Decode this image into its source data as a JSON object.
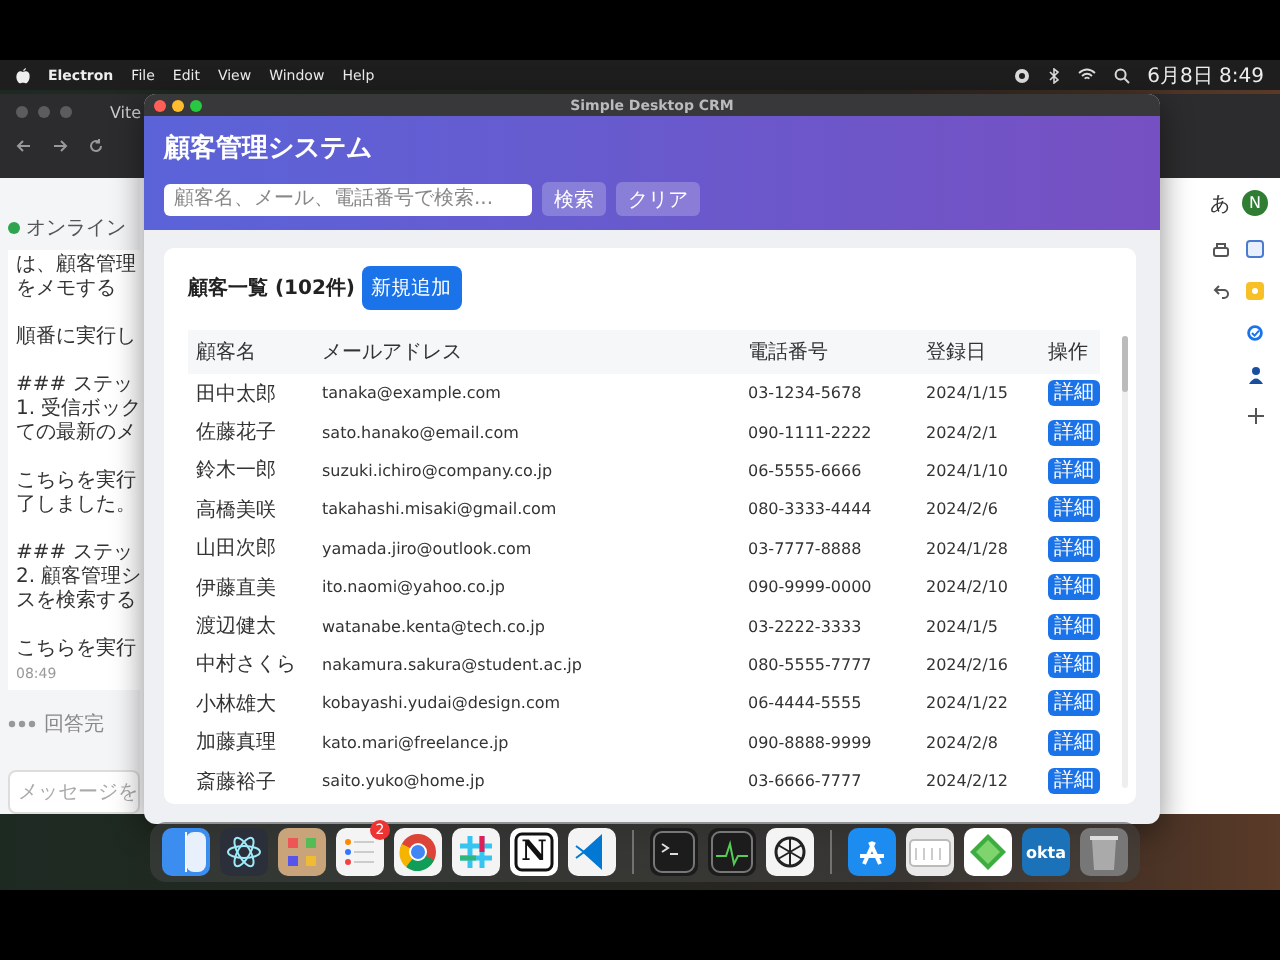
{
  "menubar": {
    "app": "Electron",
    "menus": [
      "File",
      "Edit",
      "View",
      "Window",
      "Help"
    ],
    "clock": "6月8日 8:49"
  },
  "background_browser": {
    "tab": "Vite",
    "chat": {
      "status": "オンライン",
      "paragraphs": [
        [
          "は、顧客管理",
          "をメモする"
        ],
        [
          "順番に実行し"
        ],
        [
          "### ステッ",
          "1. 受信ボック",
          "ての最新のメ"
        ],
        [
          "こちらを実行",
          "了しました。"
        ],
        [
          "### ステッ",
          "2. 顧客管理シ",
          "スを検索する"
        ],
        [
          "こちらを実行"
        ]
      ],
      "time": "08:49",
      "typing": "回答完",
      "input_placeholder": "メッセージを"
    },
    "ime": "あ",
    "profile_initial": "N"
  },
  "window": {
    "title": "Simple Desktop CRM"
  },
  "header": {
    "title": "顧客管理システム",
    "search": {
      "placeholder": "顧客名、メール、電話番号で検索..."
    },
    "buttons": [
      "検索",
      "クリア"
    ]
  },
  "list": {
    "title": "顧客一覧 (102件)",
    "add_button": "新規追加",
    "columns": [
      "顧客名",
      "メールアドレス",
      "電話番号",
      "登録日",
      "操作"
    ],
    "rows": [
      {
        "name": "田中太郎",
        "email": "tanaka@example.com",
        "phone": "03-1234-5678",
        "date": "2024/1/15",
        "action": "詳細"
      },
      {
        "name": "佐藤花子",
        "email": "sato.hanako@email.com",
        "phone": "090-1111-2222",
        "date": "2024/2/1",
        "action": "詳細"
      },
      {
        "name": "鈴木一郎",
        "email": "suzuki.ichiro@company.co.jp",
        "phone": "06-5555-6666",
        "date": "2024/1/10",
        "action": "詳細"
      },
      {
        "name": "高橋美咲",
        "email": "takahashi.misaki@gmail.com",
        "phone": "080-3333-4444",
        "date": "2024/2/6",
        "action": "詳細"
      },
      {
        "name": "山田次郎",
        "email": "yamada.jiro@outlook.com",
        "phone": "03-7777-8888",
        "date": "2024/1/28",
        "action": "詳細"
      },
      {
        "name": "伊藤直美",
        "email": "ito.naomi@yahoo.co.jp",
        "phone": "090-9999-0000",
        "date": "2024/2/10",
        "action": "詳細"
      },
      {
        "name": "渡辺健太",
        "email": "watanabe.kenta@tech.co.jp",
        "phone": "03-2222-3333",
        "date": "2024/1/5",
        "action": "詳細"
      },
      {
        "name": "中村さくら",
        "email": "nakamura.sakura@student.ac.jp",
        "phone": "080-5555-7777",
        "date": "2024/2/16",
        "action": "詳細"
      },
      {
        "name": "小林雄大",
        "email": "kobayashi.yudai@design.com",
        "phone": "06-4444-5555",
        "date": "2024/1/22",
        "action": "詳細"
      },
      {
        "name": "加藤真理",
        "email": "kato.mari@freelance.jp",
        "phone": "090-8888-9999",
        "date": "2024/2/8",
        "action": "詳細"
      },
      {
        "name": "斎藤裕子",
        "email": "saito.yuko@home.jp",
        "phone": "03-6666-7777",
        "date": "2024/2/12",
        "action": "詳細"
      }
    ]
  },
  "dock": [
    [
      {
        "kind": "finder"
      },
      {
        "kind": "atom"
      },
      {
        "kind": "grid"
      },
      {
        "kind": "list",
        "badge": "2"
      },
      {
        "kind": "browser"
      },
      {
        "kind": "hash"
      },
      {
        "kind": "letter",
        "label": "N"
      },
      {
        "kind": "code"
      }
    ],
    [
      {
        "kind": "terminal"
      },
      {
        "kind": "monitor"
      },
      {
        "kind": "knot"
      }
    ],
    [
      {
        "kind": "store"
      },
      {
        "kind": "folder"
      },
      {
        "kind": "diamond"
      },
      {
        "kind": "word",
        "label": "okta"
      },
      {
        "kind": "trash"
      }
    ]
  ]
}
